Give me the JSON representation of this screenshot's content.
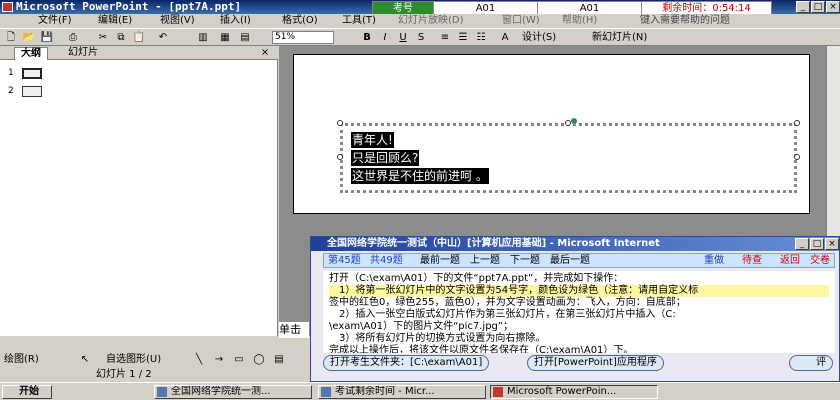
{
  "title_bar": {
    "title": "Microsoft PowerPoint - [ppt7A.ppt]"
  },
  "exam_timer": {
    "tab_label": "考号",
    "exam_id_1": "A01",
    "exam_id_2": "A01",
    "countdown": "剩余时间：0:54:14"
  },
  "menu": [
    "文件(F)",
    "编辑(E)",
    "视图(V)",
    "插入(I)",
    "格式(O)",
    "工具(T)",
    "幻灯片放映(D)",
    "窗口(W)",
    "帮助(H)"
  ],
  "help_search_placeholder": "键入需要帮助的问题",
  "toolbar": {
    "zoom": "51%",
    "design_label": "设计(S)",
    "new_slide_label": "新幻灯片(N)"
  },
  "left_panel": {
    "tab_outline": "大纲",
    "tab_slides": "幻灯片",
    "slides": [
      "1",
      "2"
    ]
  },
  "slide": {
    "lines": [
      "青年人!",
      "只是回顾么?",
      "这世界是不住的前进呵 。"
    ]
  },
  "notes_label": "单击",
  "drawing_toolbar": {
    "draw_label": "绘图(R)",
    "autoshape_label": "自选图形(U)"
  },
  "status_bar": {
    "slide_info": "幻灯片 1 / 2"
  },
  "exam_window": {
    "title": "全国网络学院统一测试（中山）[计算机应用基础] - Microsoft Internet",
    "question_num": "第45题",
    "total": "共49题",
    "nav": [
      "最前一题",
      "上一题",
      "下一题",
      "最后一题"
    ],
    "actions": [
      "重做",
      "待查",
      "返回",
      "交卷"
    ],
    "content": [
      "打开（C:\\exam\\A01）下的文件“ppt7A.ppt”，并完成如下操作：",
      "1）将第一张幻灯片中的文字设置为54号字，颜色设为绿色（注意：请用自定义标",
      "签中的红色0，绿色255，蓝色0），并为文字设置动画为：飞入，方向：自底部；",
      "2）插入一张空白版式幻灯片作为第三张幻灯片，在第三张幻灯片中插入（C:",
      "\\exam\\A01）下的图片文件“pic7.jpg”；",
      "3）将所有幻灯片的切换方式设置为向右擦除。",
      "完成以上操作后，将该文件以原文件名保存在（C:\\exam\\A01）下。"
    ],
    "btn_open_folder": "打开考生文件夹：[C:\\exam\\A01]",
    "btn_open_app": "打开[PowerPoint]应用程序",
    "btn_grade": "评"
  },
  "taskbar": {
    "start": "开始",
    "tasks": [
      "全国网络学院统一测...",
      "考试剩余时间 - Micr...",
      "Microsoft PowerPoin..."
    ]
  }
}
